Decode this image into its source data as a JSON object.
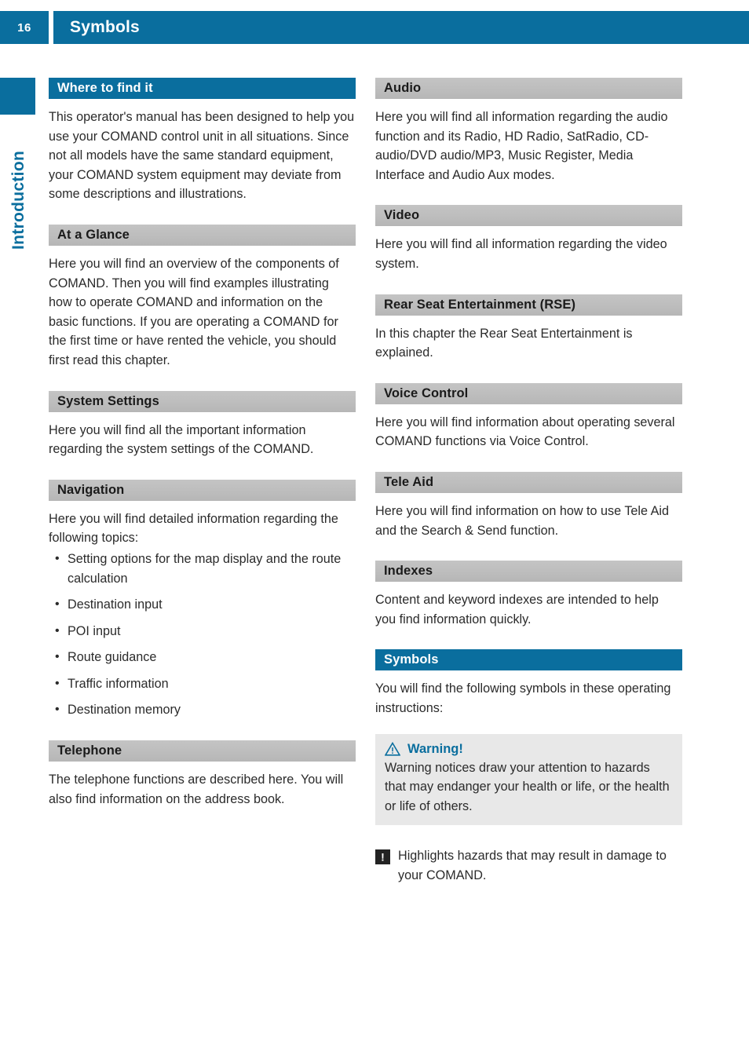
{
  "header": {
    "page_number": "16",
    "title": "Symbols"
  },
  "chapter_tab": {
    "label": "Introduction"
  },
  "colors": {
    "brand_blue": "#0a6e9e",
    "header_gray": "#bdbdbd",
    "callout_gray": "#e8e8e8",
    "body_text": "#2b2b2b"
  },
  "left_column": {
    "sections": [
      {
        "heading": "Where to find it",
        "style": "blue",
        "body": "This operator's manual has been designed to help you use your COMAND control unit in all situations. Since not all models have the same standard equipment, your COMAND system equipment may deviate from some descriptions and illustrations."
      },
      {
        "heading": "At a Glance",
        "style": "gray",
        "body": "Here you will find an overview of the components of COMAND. Then you will find examples illustrating how to operate COMAND and information on the basic functions. If you are operating a COMAND for the first time or have rented the vehicle, you should first read this chapter."
      },
      {
        "heading": "System Settings",
        "style": "gray",
        "body": "Here you will find all the important information regarding the system settings of the COMAND."
      },
      {
        "heading": "Navigation",
        "style": "gray",
        "body": "Here you will find detailed information regarding the following topics:",
        "bullets": [
          "Setting options for the map display and the route calculation",
          "Destination input",
          "POI input",
          "Route guidance",
          "Traffic information",
          "Destination memory"
        ]
      },
      {
        "heading": "Telephone",
        "style": "gray",
        "body": "The telephone functions are described here. You will also find information on the address book."
      }
    ]
  },
  "right_column": {
    "sections": [
      {
        "heading": "Audio",
        "style": "gray",
        "body": "Here you will find all information regarding the audio function and its Radio, HD Radio, SatRadio, CD-audio/DVD audio/MP3, Music Register, Media Interface and Audio Aux modes."
      },
      {
        "heading": "Video",
        "style": "gray",
        "body": "Here you will find all information regarding the video system."
      },
      {
        "heading": "Rear Seat Entertainment (RSE)",
        "style": "gray",
        "body": "In this chapter the Rear Seat Entertainment is explained."
      },
      {
        "heading": "Voice Control",
        "style": "gray",
        "body": "Here you will find information about operating several COMAND functions via Voice Control."
      },
      {
        "heading": "Tele Aid",
        "style": "gray",
        "body": "Here you will find information on how to use Tele Aid and the Search & Send function."
      },
      {
        "heading": "Indexes",
        "style": "gray",
        "body": "Content and keyword indexes are intended to help you find information quickly."
      },
      {
        "heading": "Symbols",
        "style": "blue",
        "body": "You will find the following symbols in these operating instructions:"
      }
    ],
    "warning_box": {
      "icon": "warning-triangle-icon",
      "title": "Warning!",
      "text": "Warning notices draw your attention to hazards that may endanger your health or life, or the health or life of others."
    },
    "note_line": {
      "icon": "exclamation-square-icon",
      "text": "Highlights hazards that may result in damage to your COMAND."
    }
  }
}
